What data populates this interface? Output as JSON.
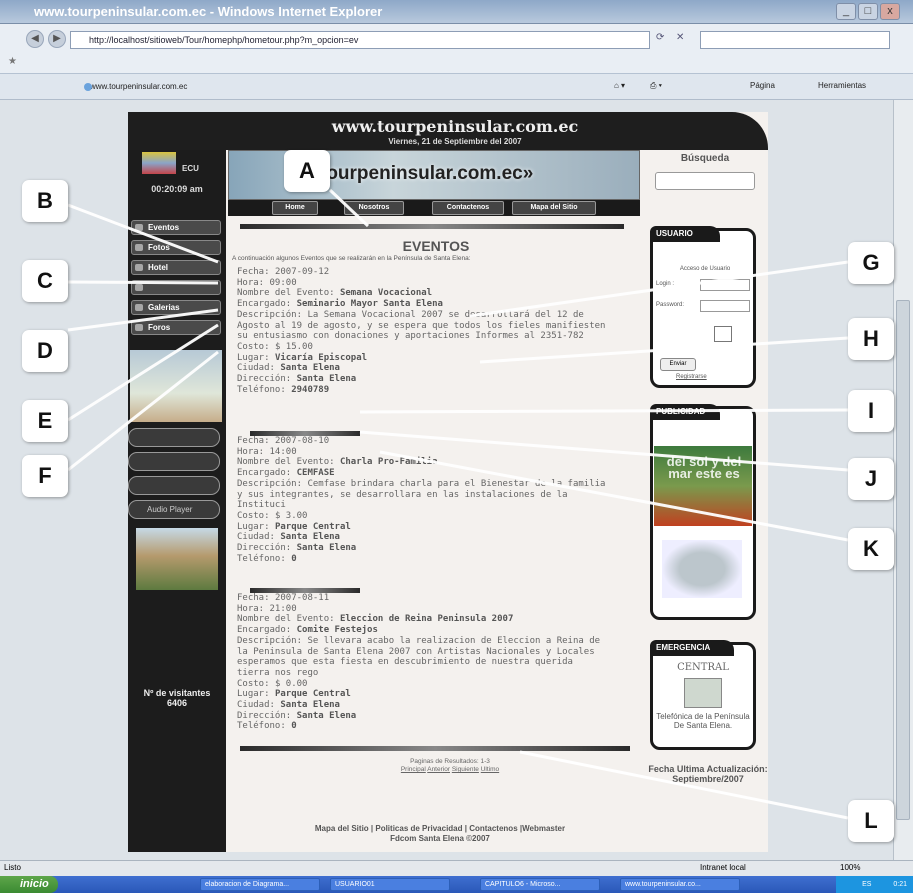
{
  "window": {
    "title": "www.tourpeninsular.com.ec - Windows Internet Explorer",
    "controls": [
      "_",
      "□",
      "x"
    ]
  },
  "browser": {
    "address": "http://localhost/sitioweb/Tour/homephp/hometour.php?m_opcion=ev",
    "tab_label": "www.tourpeninsular.com.ec",
    "page_menu": "Página",
    "tools_menu": "Herramientas",
    "status_left": "Listo",
    "zone": "Intranet local",
    "zoom": "100%"
  },
  "site": {
    "domain": "www.tourpeninsular.com.ec",
    "date": "Viernes, 21 de Septiembre del 2007",
    "country_code": "ECU",
    "clock": "00:20:09 am",
    "banner_text": "tourpeninsular.com.ec»",
    "top_nav": [
      "Home",
      "Nosotros",
      "Contactenos",
      "Mapa del Sitio"
    ],
    "left_nav": [
      "Eventos",
      "Fotos",
      "Hotel",
      "",
      "Galerias",
      "Foros"
    ],
    "left_pills": [
      "",
      "",
      "",
      "Audio Player"
    ],
    "visitors_label": "Nº de visitantes",
    "visitors_count": "6406",
    "section_title": "EVENTOS",
    "intro": "A continuación algunos Eventos que se realizarán en la Península de Santa Elena:",
    "labels": {
      "fecha": "Fecha:",
      "hora": "Hora:",
      "nombre": "Nombre del Evento:",
      "encargado": "Encargado:",
      "descripcion": "Descripción:",
      "costo": "Costo:",
      "lugar": "Lugar:",
      "ciudad": "Ciudad:",
      "direccion": "Dirección:",
      "telefono": "Teléfono:"
    },
    "events": [
      {
        "fecha": "2007-09-12",
        "hora": "09:00",
        "nombre": "Semana Vocacional",
        "encargado": "Seminario Mayor Santa Elena",
        "descripcion": "La Semana Vocacional 2007 se desarrollará del 12 de Agosto al 19 de agosto, y se espera que todos los fieles manifiesten su entusiasmo con donaciones y aportaciones Informes al 2351-782",
        "costo": "$ 15.00",
        "lugar": "Vicaría Episcopal",
        "ciudad": "Santa Elena",
        "direccion": "Santa Elena",
        "telefono": "2940789"
      },
      {
        "fecha": "2007-08-10",
        "hora": "14:00",
        "nombre": "Charla Pro-Familia",
        "encargado": "CEMFASE",
        "descripcion": "Cemfase brindara charla para el Bienestar de la familia y sus integrantes, se desarrollara en las instalaciones de la Instituci",
        "costo": "$ 3.00",
        "lugar": "Parque Central",
        "ciudad": "Santa Elena",
        "direccion": "Santa Elena",
        "telefono": "0"
      },
      {
        "fecha": "2007-08-11",
        "hora": "21:00",
        "nombre": "Eleccion de Reina Peninsula 2007",
        "encargado": "Comite Festejos",
        "descripcion": "Se llevara acabo la realizacion de Eleccion a Reina de la Peninsula de Santa Elena 2007 con Artistas Nacionales y Locales esperamos que esta fiesta en descubrimiento de nuestra querida tierra nos rego",
        "costo": "$ 0.00",
        "lugar": "Parque Central",
        "ciudad": "Santa Elena",
        "direccion": "Santa Elena",
        "telefono": "0"
      }
    ],
    "pager": {
      "results": "Paginas de Resultados: 1-3",
      "links": [
        "Principal",
        "Anterior",
        "Siguiente",
        "Ultimo"
      ]
    },
    "footer": {
      "links": "Mapa del Sitio | Politicas de Privacidad | Contactenos |Webmaster",
      "copyright": "Fdcom Santa Elena ©2007"
    },
    "right": {
      "search_title": "Búsqueda",
      "usuario_title": "USUARIO",
      "access_label": "Acceso de Usuario",
      "user_label": "Login :",
      "pass_label": "Password:",
      "enter_button": "Enviar",
      "register_link": "Registrarse",
      "publicidad_title": "PUBLICIDAD",
      "pub_text": "del sol y del mar este es",
      "emergencia_title": "EMERGENCIA",
      "central": "CENTRAL",
      "central_info": "Telefónica de la Península De Santa Elena.",
      "update_label": "Fecha Ultima Actualización:",
      "update_date": "Septiembre/2007"
    }
  },
  "taskbar": {
    "start": "inicio",
    "tasks": [
      "elaboracion de Diagrama...",
      "USUARIO01",
      "CAPITULO6 - Microso...",
      "www.tourpeninsular.co..."
    ],
    "lang": "ES",
    "time": "0:21"
  },
  "callouts": [
    "A",
    "B",
    "C",
    "D",
    "E",
    "F",
    "G",
    "H",
    "I",
    "J",
    "K",
    "L"
  ],
  "colors": {
    "site_dark": "#1c1c1c",
    "callout_bg": "#ffffff",
    "ie_title": "#8ea8c8"
  }
}
